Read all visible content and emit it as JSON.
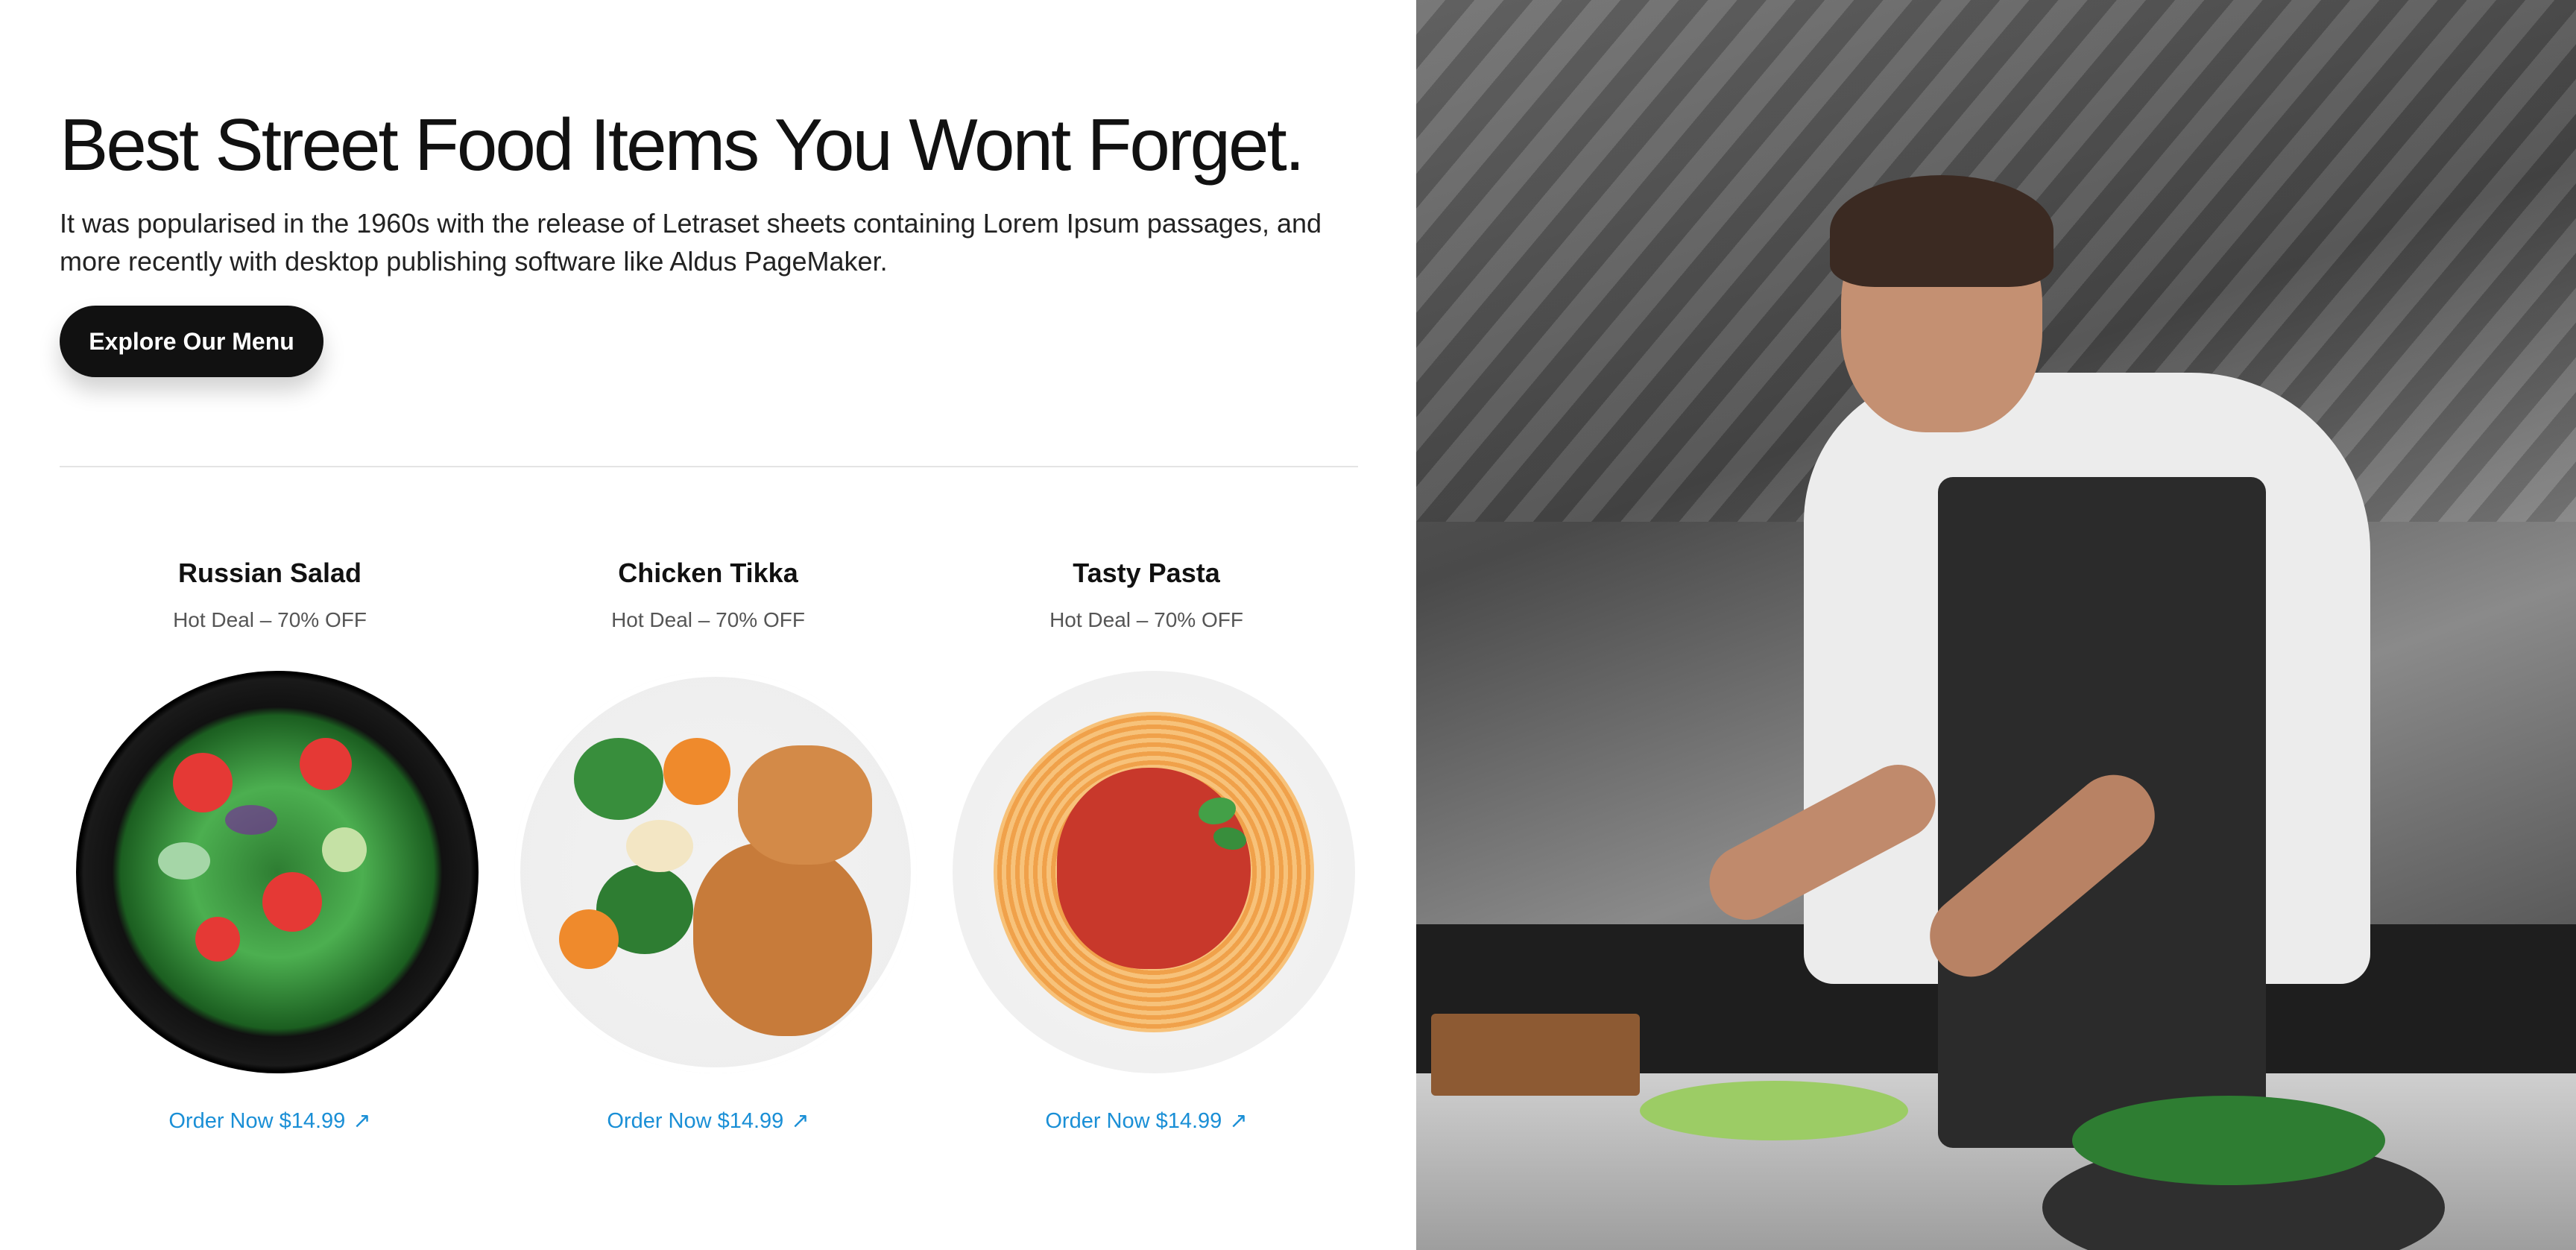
{
  "hero": {
    "title": "Best Street Food Items You Wont Forget.",
    "description": "It was popularised in the 1960s with the release of Letraset sheets containing Lorem Ipsum passages, and more recently with desktop publishing software like Aldus PageMaker.",
    "cta_label": "Explore Our Menu"
  },
  "menu": {
    "items": [
      {
        "name": "Russian Salad",
        "deal": "Hot Deal – 70% OFF",
        "order_label": "Order Now $14.99",
        "arrow": "↗"
      },
      {
        "name": "Chicken Tikka",
        "deal": "Hot Deal – 70% OFF",
        "order_label": "Order Now $14.99",
        "arrow": "↗"
      },
      {
        "name": "Tasty Pasta",
        "deal": "Hot Deal – 70% OFF",
        "order_label": "Order Now $14.99",
        "arrow": "↗"
      }
    ]
  },
  "colors": {
    "accent": "#1a8fd6",
    "cta_background": "#111111",
    "text": "#111111"
  }
}
